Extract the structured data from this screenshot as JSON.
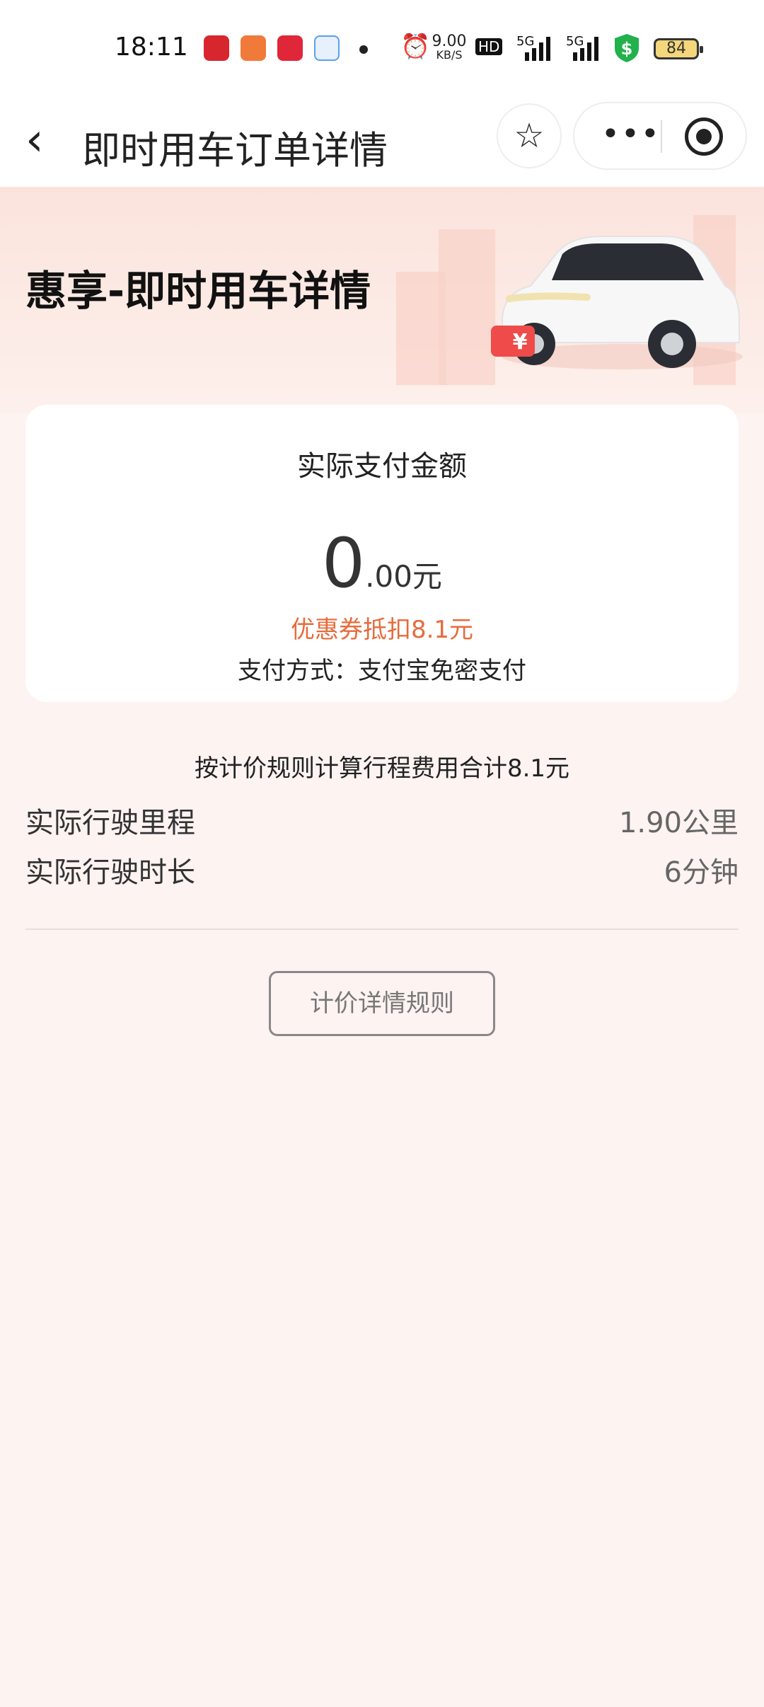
{
  "status_bar": {
    "time": "18:11",
    "net_speed": "9.00",
    "net_unit": "KB/S",
    "hd": "HD",
    "sig1": "5G",
    "sig2": "5G",
    "battery": "84"
  },
  "nav": {
    "title": "即时用车订单详情",
    "more_label": "•••"
  },
  "hero": {
    "title": "惠享-即时用车详情",
    "badge": "¥"
  },
  "payment": {
    "label": "实际支付金额",
    "amount_int": "0",
    "amount_dec": ".00",
    "currency": "元",
    "coupon": "优惠券抵扣8.1元",
    "method": "支付方式：支付宝免密支付"
  },
  "trip": {
    "total": "按计价规则计算行程费用合计8.1元",
    "distance_label": "实际行驶里程",
    "distance_value": "1.90公里",
    "duration_label": "实际行驶时长",
    "duration_value": "6分钟"
  },
  "rules_button": "计价详情规则",
  "colors": {
    "accent": "#e66b3c",
    "page_bg": "#fdf3f1"
  }
}
